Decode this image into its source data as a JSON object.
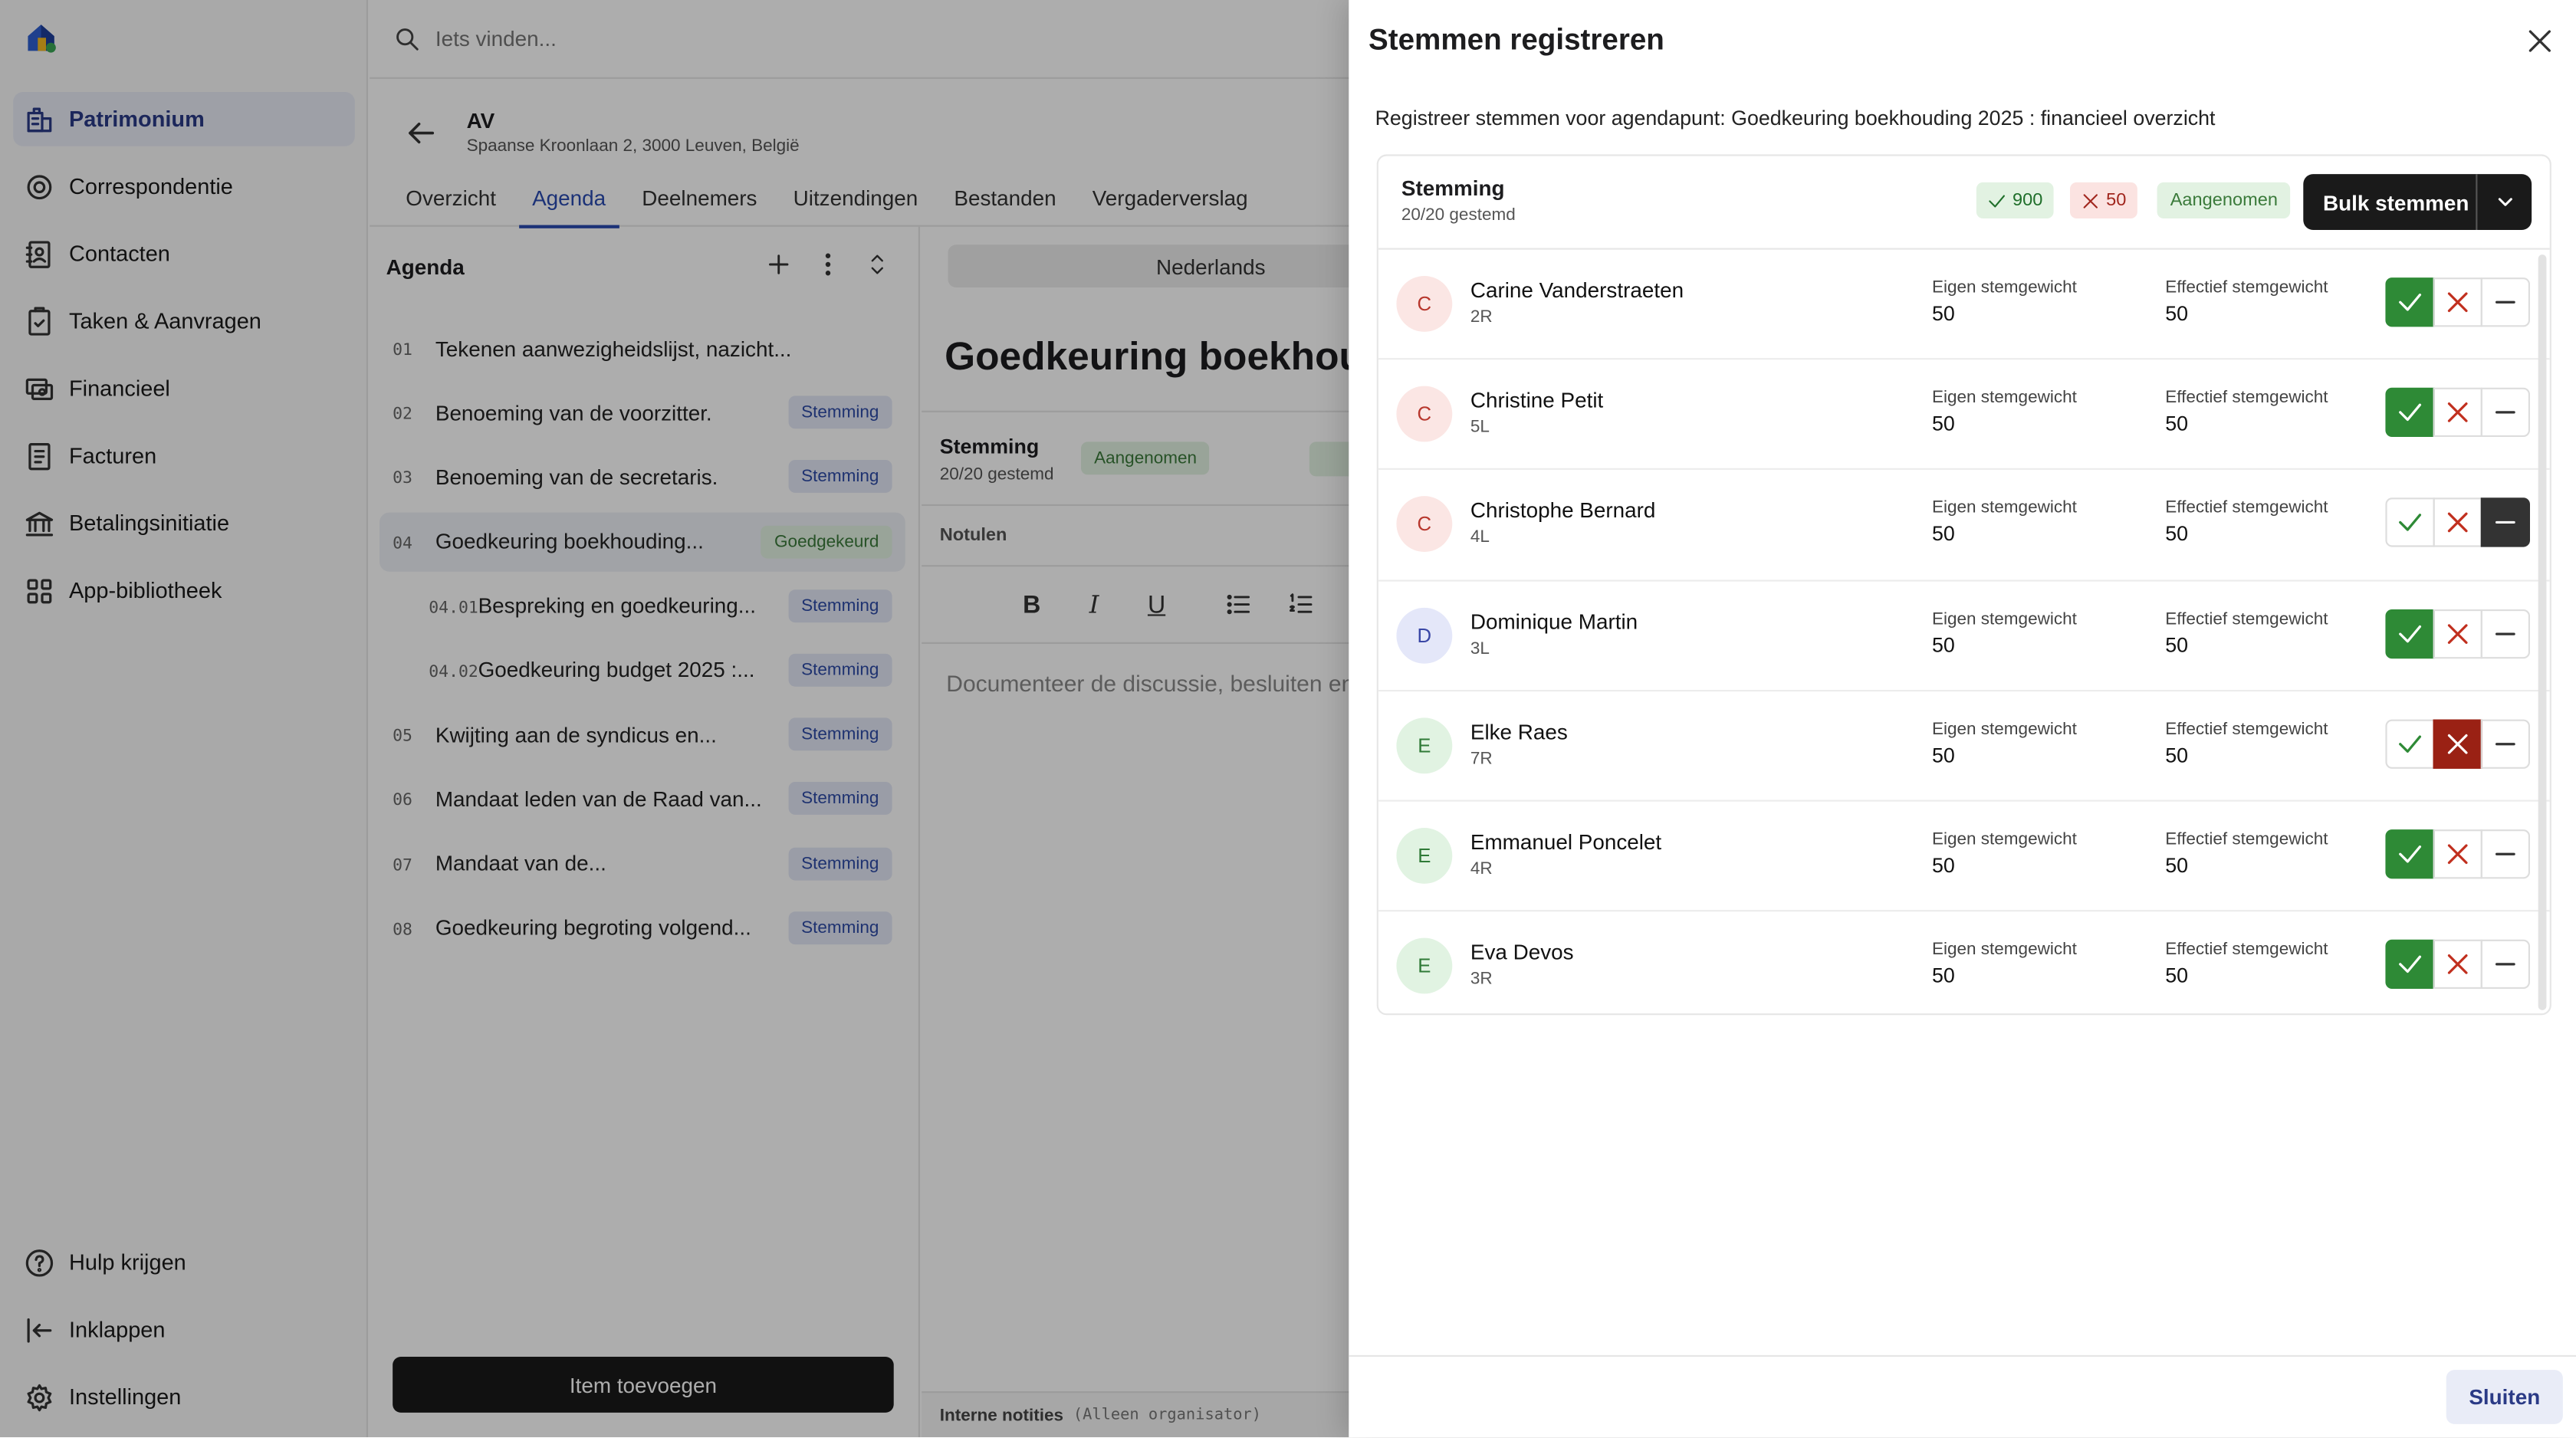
{
  "search": {
    "placeholder": "Iets vinden..."
  },
  "sidebar": {
    "items": [
      {
        "label": "Patrimonium",
        "icon": "building-icon",
        "active": true
      },
      {
        "label": "Correspondentie",
        "icon": "at-sign-icon"
      },
      {
        "label": "Contacten",
        "icon": "contacts-book-icon"
      },
      {
        "label": "Taken & Aanvragen",
        "icon": "clipboard-check-icon"
      },
      {
        "label": "Financieel",
        "icon": "coins-icon"
      },
      {
        "label": "Facturen",
        "icon": "invoice-icon"
      },
      {
        "label": "Betalingsinitiatie",
        "icon": "bank-icon"
      },
      {
        "label": "App-bibliotheek",
        "icon": "grid-icon"
      }
    ],
    "bottom": [
      {
        "label": "Hulp krijgen",
        "icon": "help-icon"
      },
      {
        "label": "Inklappen",
        "icon": "collapse-icon"
      },
      {
        "label": "Instellingen",
        "icon": "gear-icon"
      }
    ]
  },
  "header": {
    "title": "AV",
    "subtitle": "Spaanse Kroonlaan 2, 3000 Leuven, België",
    "tabs": [
      "Overzicht",
      "Agenda",
      "Deelnemers",
      "Uitzendingen",
      "Bestanden",
      "Vergaderverslag"
    ],
    "active_tab": "Agenda"
  },
  "agenda": {
    "title": "Agenda",
    "items": [
      {
        "num": "01",
        "text": "Tekenen aanwezigheidslijst, nazicht...",
        "badge": ""
      },
      {
        "num": "02",
        "text": "Benoeming van de voorzitter.",
        "badge": "Stemming"
      },
      {
        "num": "03",
        "text": "Benoeming van de secretaris.",
        "badge": "Stemming"
      },
      {
        "num": "04",
        "text": "Goedkeuring boekhouding...",
        "badge": "Goedgekeurd"
      },
      {
        "num": "04.01",
        "text": "Bespreking en goedkeuring...",
        "badge": "Stemming"
      },
      {
        "num": "04.02",
        "text": "Goedkeuring budget 2025 :...",
        "badge": "Stemming"
      },
      {
        "num": "05",
        "text": "Kwijting aan de syndicus en...",
        "badge": "Stemming"
      },
      {
        "num": "06",
        "text": "Mandaat leden van de Raad van...",
        "badge": "Stemming"
      },
      {
        "num": "07",
        "text": "Mandaat van de...",
        "badge": "Stemming"
      },
      {
        "num": "08",
        "text": "Goedkeuring begroting volgend...",
        "badge": "Stemming"
      }
    ],
    "add_button": "Item toevoegen"
  },
  "editor": {
    "language": "Nederlands",
    "title": "Goedkeuring boekhoudi",
    "vote_label": "Stemming",
    "vote_sub": "20/20 gestemd",
    "vote_status": "Aangenomen",
    "notes_label": "Notulen",
    "toolbar": {
      "bold": "B",
      "italic": "I",
      "underline": "U"
    },
    "placeholder": "Documenteer de discussie, besluiten en",
    "internal_label": "Interne notities",
    "internal_note": "(Alleen organisator)"
  },
  "panel": {
    "title": "Stemmen registreren",
    "description": "Registreer stemmen voor agendapunt: Goedkeuring boekhouding 2025 : financieel overzicht",
    "summary": {
      "label": "Stemming",
      "sub": "20/20 gestemd",
      "yes": "900",
      "no": "50",
      "status": "Aangenomen",
      "bulk": "Bulk stemmen"
    },
    "col_own": "Eigen stemgewicht",
    "col_eff": "Effectief stemgewicht",
    "voters": [
      {
        "initial": "C",
        "name": "Carine Vanderstraeten",
        "unit": "2R",
        "own": "50",
        "eff": "50",
        "vote": "yes"
      },
      {
        "initial": "C",
        "name": "Christine Petit",
        "unit": "5L",
        "own": "50",
        "eff": "50",
        "vote": "yes"
      },
      {
        "initial": "C",
        "name": "Christophe Bernard",
        "unit": "4L",
        "own": "50",
        "eff": "50",
        "vote": "abstain"
      },
      {
        "initial": "D",
        "name": "Dominique Martin",
        "unit": "3L",
        "own": "50",
        "eff": "50",
        "vote": "yes"
      },
      {
        "initial": "E",
        "name": "Elke Raes",
        "unit": "7R",
        "own": "50",
        "eff": "50",
        "vote": "no"
      },
      {
        "initial": "E",
        "name": "Emmanuel Poncelet",
        "unit": "4R",
        "own": "50",
        "eff": "50",
        "vote": "yes"
      },
      {
        "initial": "E",
        "name": "Eva Devos",
        "unit": "3R",
        "own": "50",
        "eff": "50",
        "vote": "yes"
      }
    ],
    "close_button": "Sluiten"
  }
}
